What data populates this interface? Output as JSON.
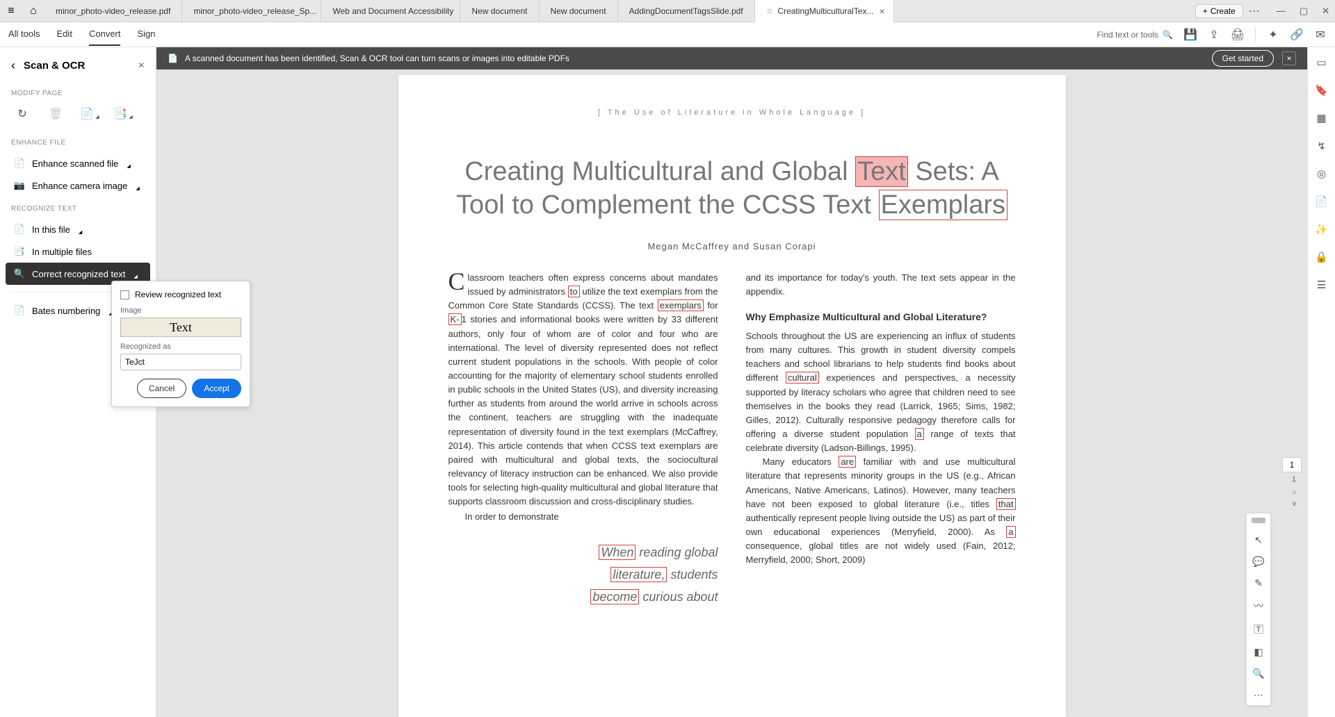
{
  "tabs": [
    {
      "label": "minor_photo-video_release.pdf"
    },
    {
      "label": "minor_photo-video_release_Sp..."
    },
    {
      "label": "Web and Document Accessibility"
    },
    {
      "label": "New document"
    },
    {
      "label": "New document"
    },
    {
      "label": "AddingDocumentTagsSlide.pdf"
    },
    {
      "label": "CreatingMulticulturalTex...",
      "active": true
    }
  ],
  "create_label": "Create",
  "toolbar": {
    "all_tools": "All tools",
    "edit": "Edit",
    "convert": "Convert",
    "sign": "Sign",
    "find": "Find text or tools"
  },
  "sidebar": {
    "title": "Scan & OCR",
    "modify_page": "MODIFY PAGE",
    "enhance_file": "ENHANCE FILE",
    "enhance_scanned": "Enhance scanned file",
    "enhance_camera": "Enhance camera image",
    "recognize_text": "RECOGNIZE TEXT",
    "in_this_file": "In this file",
    "in_multiple_files": "In multiple files",
    "correct_recognized": "Correct recognized text",
    "bates": "Bates numbering"
  },
  "popup": {
    "review": "Review recognized text",
    "image_label": "Image",
    "image_text": "Text",
    "recognized_label": "Recognized as",
    "recognized_value": "TeJct",
    "cancel": "Cancel",
    "accept": "Accept"
  },
  "banner": {
    "text": "A scanned document has been identified, Scan & OCR tool can turn scans or images into editable PDFs",
    "get_started": "Get started"
  },
  "doc": {
    "header": "[ The Use of Literature in Whole Language ]",
    "title_1": "Creating Multicultural and Global ",
    "title_text": "Text",
    "title_2": " Sets: A Tool to Complement the CCSS Text ",
    "title_exemplars": "Exemplars",
    "authors": "Megan McCaffrey and Susan Corapi",
    "col1_dropcap": "C",
    "col1_p1a": "lassroom teachers often express concerns about mandates issued by administrators ",
    "hl_to": "to",
    "col1_p1b": " utilize the text exemplars from the Common Core State Standards (CCSS). The text ",
    "hl_exemplars": "exemplars",
    "col1_p1c": " for ",
    "hl_k": "K-",
    "col1_p1d": "1 stories and informational books were written by 33 different authors, only four of whom are of color and four who are international. The level of diversity represented does not reflect current student populations in the schools. With people of color accounting for the majority of elementary school students enrolled in public schools in the United States (US), and diversity increasing further as students from around the world arrive in schools across the continent, teachers are struggling with the inadequate representation of diversity found in the text exemplars (McCaffrey, 2014). This article contends that when CCSS text exemplars are paired with multicultural and global texts, the sociocultural relevancy of literacy instruction can be enhanced. We also provide tools for selecting high-quality multicultural and global literature that supports classroom discussion and cross-disciplinary studies.",
    "col1_p2": "In order to demonstrate",
    "pull_when": "When",
    "pull_1": " reading global ",
    "pull_literature": "literature,",
    "pull_2": " students ",
    "pull_become": "become",
    "pull_3": " curious about",
    "col2_p1": "and its importance for today's youth. The text sets appear in the appendix.",
    "col2_h1": "Why Emphasize Multicultural and Global Literature?",
    "col2_p2a": "Schools throughout the US are experiencing an influx of students from many cultures. This growth in student diversity compels teachers and school librarians to help students find books about different ",
    "hl_cultural": "cultural",
    "col2_p2b": " experiences and perspectives, a necessity supported by literacy scholars who agree that children need to see themselves in the books they read (Larrick, 1965; Sims, 1982; Gilles, 2012). Culturally responsive pedagogy therefore calls for offering a diverse student population ",
    "hl_a": "a",
    "col2_p2c": " range of texts that celebrate diversity (Ladson-Billings, 1995).",
    "col2_p3a": "Many educators ",
    "hl_are": "are",
    "col2_p3b": " familiar with and use multicultural literature that represents minority groups in the US (e.g., African Americans, Native Americans, Latinos). However, many teachers have not been exposed to global literature (i.e., titles ",
    "hl_that": "that",
    "col2_p3c": " authentically represent people living outside the US) as part of their own educational experiences (Merryfield, 2000). As ",
    "hl_a2": "a",
    "col2_p3d": " consequence, global titles are not widely used (Fain, 2012; Merryfield, 2000; Short, 2009)"
  },
  "page_indicator": "1",
  "page_total": "1"
}
